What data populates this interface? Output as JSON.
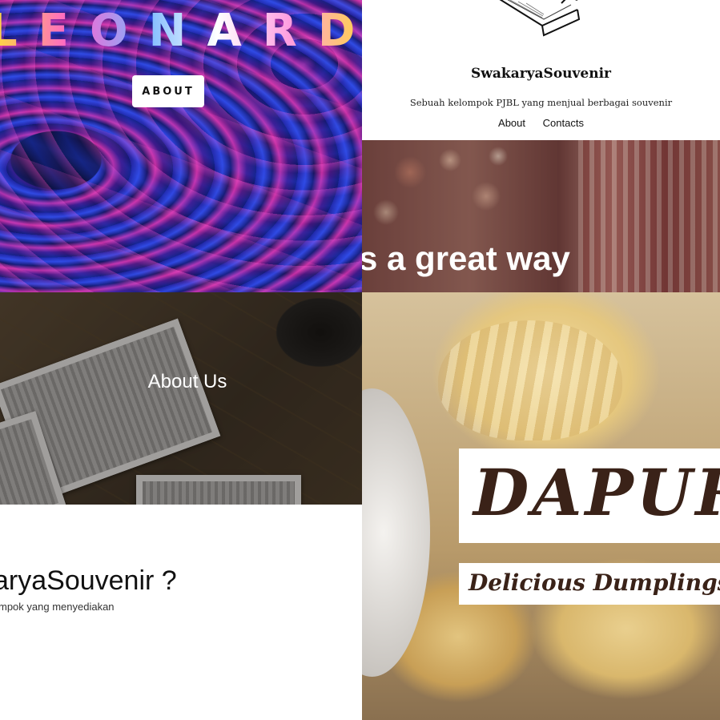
{
  "leonard": {
    "brand": "LEONARD",
    "about_button": "ABOUT"
  },
  "swakarya": {
    "site_title": "SwakaryaSouvenir",
    "subtitle": "Sebuah kelompok PJBL yang menjual berbagai souvenir",
    "nav": [
      "About",
      "Contacts"
    ],
    "hero_text": "s a great way"
  },
  "about_page": {
    "hero_heading": "About Us",
    "section_title": "aryaSouvenir ?",
    "section_subtitle": "mpok yang menyediakan"
  },
  "dapur": {
    "brand": "DAPUR",
    "tagline": "Delicious Dumplings, C"
  }
}
